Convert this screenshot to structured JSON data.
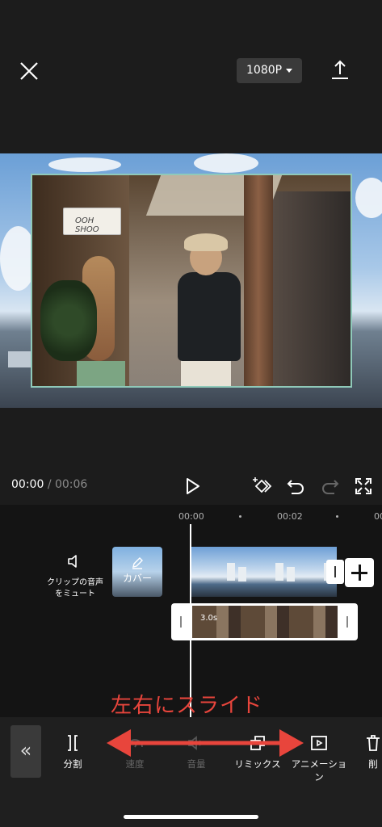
{
  "header": {
    "resolution": "1080P"
  },
  "playback": {
    "current_time": "00:00",
    "separator": "/",
    "total_time": "00:06"
  },
  "timeline": {
    "ruler": [
      "00:00",
      "00:02",
      "00"
    ],
    "mute_label": "クリップの音声をミュート",
    "cover_label": "カバー",
    "clip_duration": "3.0s"
  },
  "annotation": "左右にスライド",
  "toolbar": {
    "back_label": "«",
    "items": [
      {
        "label": "分割",
        "icon": "split-icon",
        "enabled": true
      },
      {
        "label": "速度",
        "icon": "speed-icon",
        "enabled": false
      },
      {
        "label": "音量",
        "icon": "volume-icon",
        "enabled": false
      },
      {
        "label": "リミックス",
        "icon": "remix-icon",
        "enabled": true
      },
      {
        "label": "アニメーション",
        "icon": "animation-icon",
        "enabled": true
      },
      {
        "label": "削",
        "icon": "delete-icon",
        "enabled": true
      }
    ]
  },
  "colors": {
    "annotation": "#e8453c",
    "background": "#1c1c1c"
  }
}
